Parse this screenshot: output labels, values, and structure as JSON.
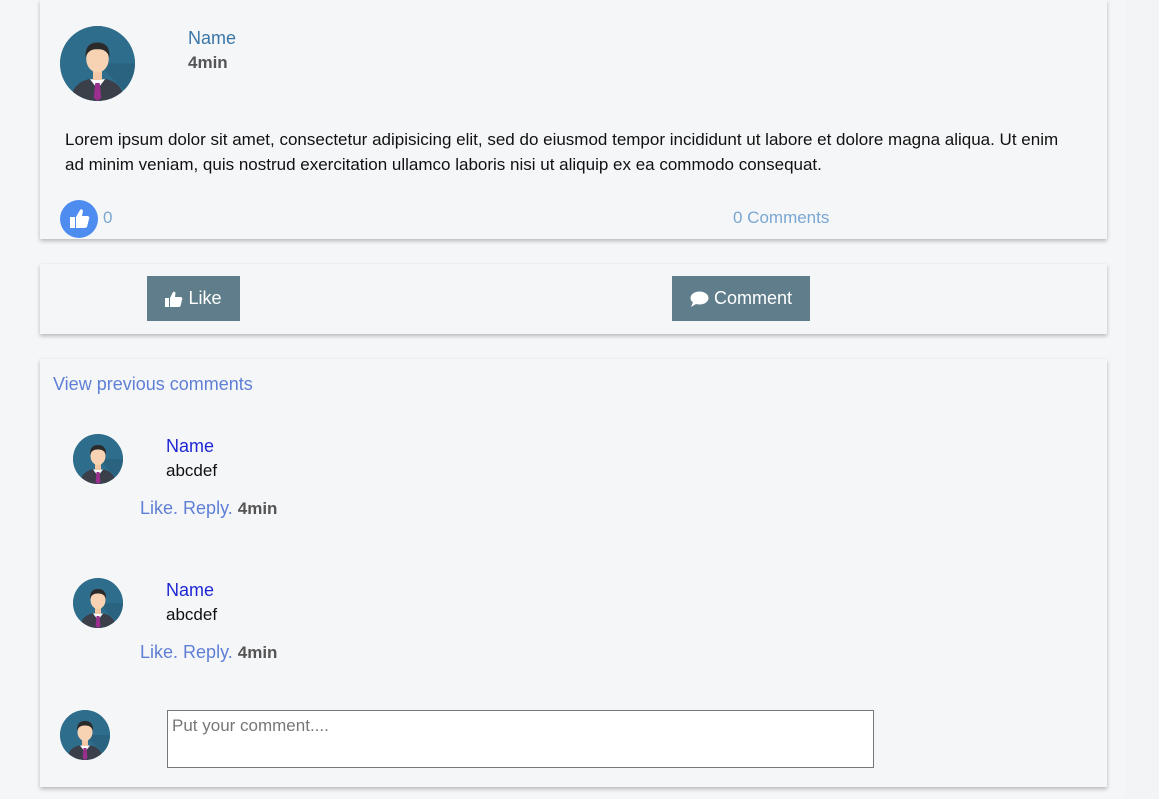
{
  "post": {
    "author": "Name",
    "time": "4min",
    "body": "Lorem ipsum dolor sit amet, consectetur adipisicing elit, sed do eiusmod tempor incididunt ut labore et dolore magna aliqua. Ut enim ad minim veniam, quis nostrud exercitation ullamco laboris nisi ut aliquip ex ea commodo consequat.",
    "like_count": "0",
    "comment_count": "0 Comments"
  },
  "actions": {
    "like_label": "Like",
    "comment_label": "Comment"
  },
  "comments": {
    "view_previous": "View previous comments",
    "items": [
      {
        "author": "Name",
        "text": "abcdef",
        "like": "Like.",
        "reply": "Reply.",
        "time": "4min"
      },
      {
        "author": "Name",
        "text": "abcdef",
        "like": "Like.",
        "reply": "Reply.",
        "time": "4min"
      }
    ],
    "input_placeholder": "Put your comment...."
  },
  "icons": {
    "avatar": "user-avatar-icon",
    "like": "thumbs-up-icon",
    "comment": "speech-bubble-icon"
  },
  "colors": {
    "button_bg": "#607d8b",
    "link": "#5f7fd6",
    "name_link": "#1f27d2",
    "like_circle": "#4e8cf0"
  }
}
